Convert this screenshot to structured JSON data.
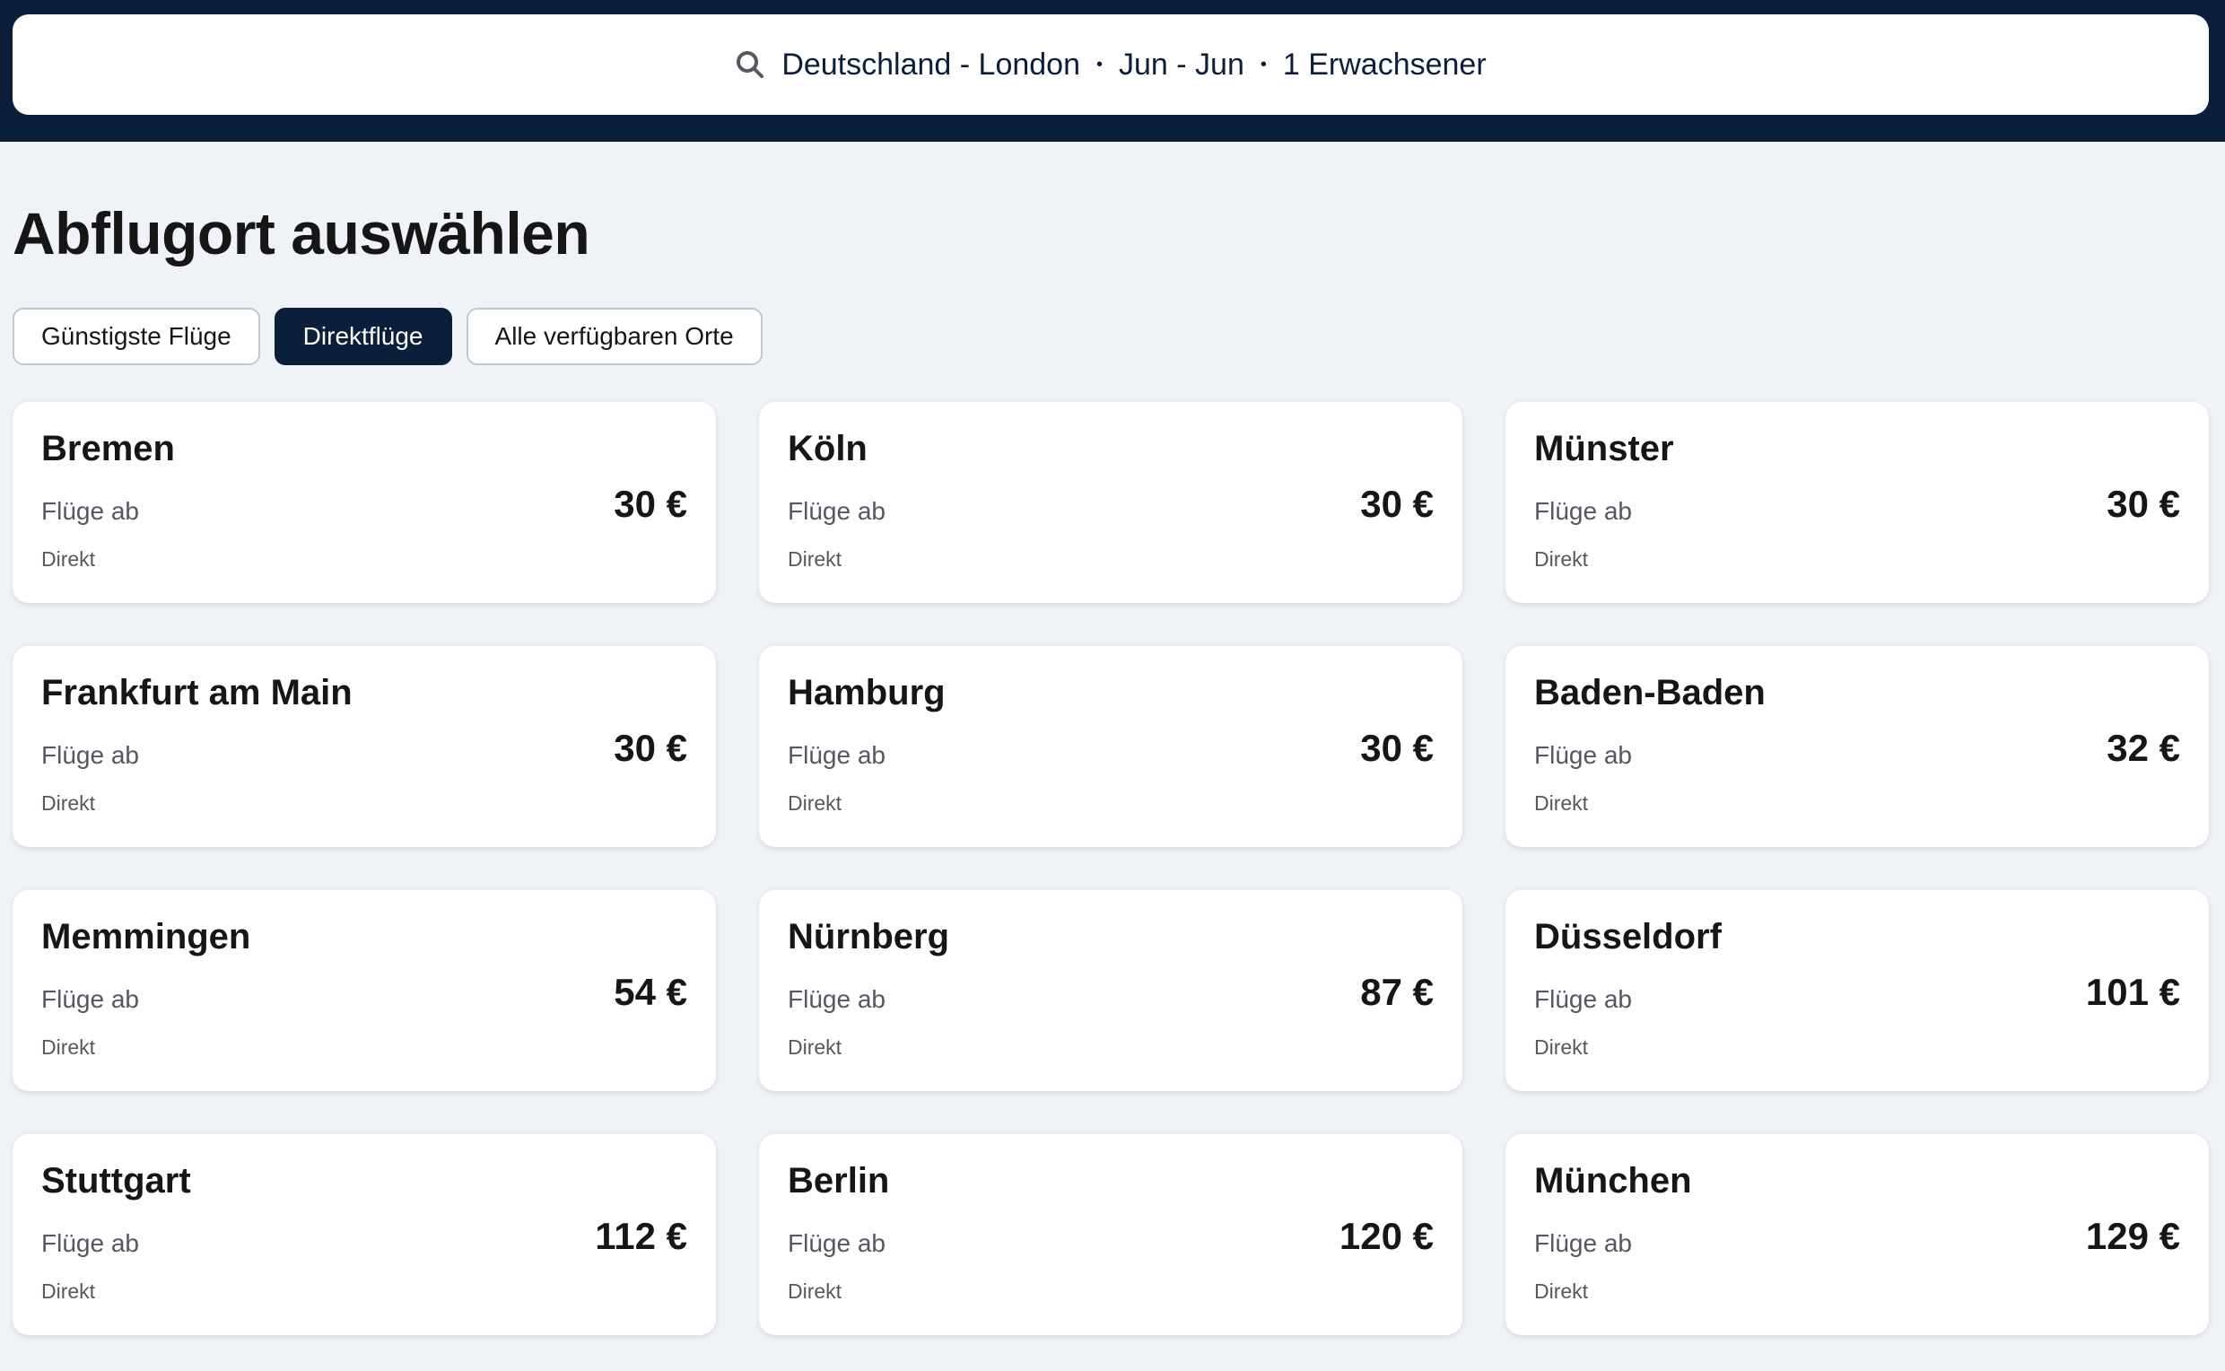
{
  "search": {
    "route": "Deutschland - London",
    "dates": "Jun - Jun",
    "passengers": "1 Erwachsener",
    "separator": "•"
  },
  "page_title": "Abflugort auswählen",
  "filters": [
    {
      "label": "Günstigste Flüge",
      "active": false
    },
    {
      "label": "Direktflüge",
      "active": true
    },
    {
      "label": "Alle verfügbaren Orte",
      "active": false
    }
  ],
  "cards": [
    {
      "city": "Bremen",
      "from_label": "Flüge ab",
      "stops": "Direkt",
      "price": "30 €"
    },
    {
      "city": "Köln",
      "from_label": "Flüge ab",
      "stops": "Direkt",
      "price": "30 €"
    },
    {
      "city": "Münster",
      "from_label": "Flüge ab",
      "stops": "Direkt",
      "price": "30 €"
    },
    {
      "city": "Frankfurt am Main",
      "from_label": "Flüge ab",
      "stops": "Direkt",
      "price": "30 €"
    },
    {
      "city": "Hamburg",
      "from_label": "Flüge ab",
      "stops": "Direkt",
      "price": "30 €"
    },
    {
      "city": "Baden-Baden",
      "from_label": "Flüge ab",
      "stops": "Direkt",
      "price": "32 €"
    },
    {
      "city": "Memmingen",
      "from_label": "Flüge ab",
      "stops": "Direkt",
      "price": "54 €"
    },
    {
      "city": "Nürnberg",
      "from_label": "Flüge ab",
      "stops": "Direkt",
      "price": "87 €"
    },
    {
      "city": "Düsseldorf",
      "from_label": "Flüge ab",
      "stops": "Direkt",
      "price": "101 €"
    },
    {
      "city": "Stuttgart",
      "from_label": "Flüge ab",
      "stops": "Direkt",
      "price": "112 €"
    },
    {
      "city": "Berlin",
      "from_label": "Flüge ab",
      "stops": "Direkt",
      "price": "120 €"
    },
    {
      "city": "München",
      "from_label": "Flüge ab",
      "stops": "Direkt",
      "price": "129 €"
    }
  ],
  "colors": {
    "header_bg": "#0b1f3a",
    "page_bg": "#eff3f8",
    "active_chip": "#0b1f3a",
    "card_bg": "#ffffff"
  },
  "icons": {
    "search": "search-icon"
  }
}
